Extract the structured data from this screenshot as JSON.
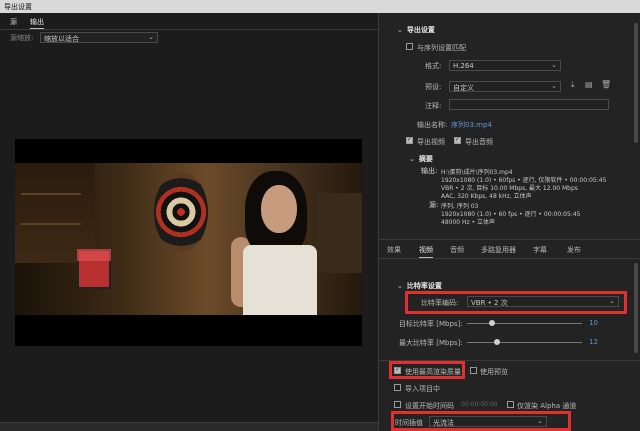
{
  "window": {
    "title": "导出设置"
  },
  "left": {
    "tabs": [
      "源",
      "输出"
    ],
    "source_scaling_label": "源缩放:",
    "source_scaling_value": "缩放以适合"
  },
  "export": {
    "section_title": "导出设置",
    "match_sequence": "与序列设置匹配",
    "format_label": "格式:",
    "format_value": "H.264",
    "preset_label": "预设:",
    "preset_value": "自定义",
    "comment_label": "注释:",
    "output_name_label": "输出名称:",
    "output_name_value": "序列03.mp4",
    "export_video": "导出视频",
    "export_audio": "导出音频",
    "summary_title": "摘要",
    "summary_output_label": "输出:",
    "summary_output_lines": [
      "H:\\蛋剪\\成片\\序列03.mp4",
      "1920x1080 (1.0) • 60fps • 逐行, 仅限软件 • 00:00:05:45",
      "VBR • 2 次, 目标 10.00 Mbps, 最大 12.00 Mbps",
      "AAC, 320 Kbps, 48 kHz, 立体声"
    ],
    "summary_source_label": "源:",
    "summary_source_lines": [
      "序列, 序列 03",
      "1920x1080 (1.0) • 60 fps • 逐行 • 00:00:05:45",
      "48000 Hz • 立体声"
    ]
  },
  "tabs2": [
    "效果",
    "视频",
    "音频",
    "多路复用器",
    "字幕",
    "发布"
  ],
  "bitrate": {
    "section_title": "比特率设置",
    "encoding_label": "比特率编码:",
    "encoding_value": "VBR • 2 次",
    "target_label": "目标比特率 [Mbps]:",
    "target_value": "10",
    "max_label": "最大比特率 [Mbps]:",
    "max_value": "12"
  },
  "bottom": {
    "use_max_quality": "使用最高渲染质量",
    "use_preview": "使用预览",
    "import_into_project": "导入项目中",
    "set_start_timecode": "设置开始时间码",
    "timecode_value": "00:00:00:00",
    "render_alpha": "仅渲染 Alpha 通道",
    "interpolation_label": "时间插值",
    "interpolation_value": "光流法"
  },
  "colors": {
    "accent_blue": "#5b9bd5",
    "highlight_red": "#e03030"
  },
  "icons": [
    "save-preset-icon",
    "import-preset-icon",
    "delete-preset-icon",
    "chevron-down-icon",
    "checkbox-icon"
  ]
}
